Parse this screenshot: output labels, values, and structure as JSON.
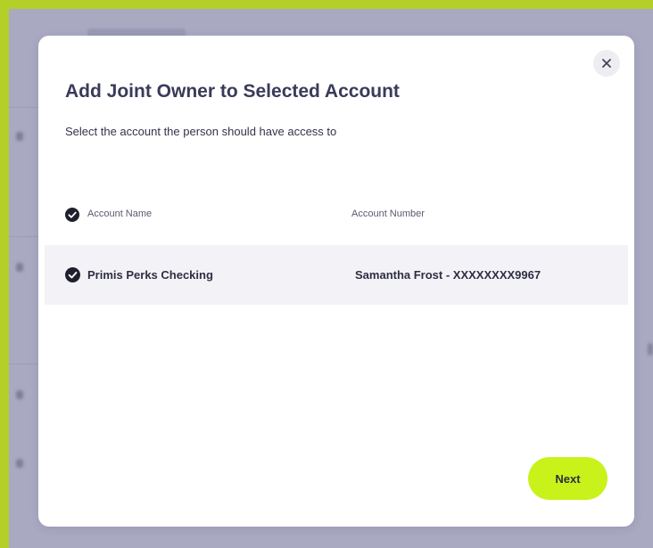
{
  "modal": {
    "title": "Add Joint Owner to Selected Account",
    "subtitle": "Select the account the person should have access to",
    "close_icon": "close-icon"
  },
  "table": {
    "columns": {
      "account_name": "Account Name",
      "account_number": "Account Number"
    },
    "header_check_icon": "check-circle-icon",
    "rows": [
      {
        "account_name": "Primis Perks Checking",
        "account_number": "Samantha Frost - XXXXXXXX9967",
        "selected": true
      }
    ]
  },
  "actions": {
    "next_label": "Next"
  },
  "colors": {
    "frame": "#b3cf28",
    "backdrop": "#a9a9c2",
    "accent_button": "#c8f21a",
    "title_text": "#3a3a5a",
    "row_highlight": "#f3f3f7"
  }
}
